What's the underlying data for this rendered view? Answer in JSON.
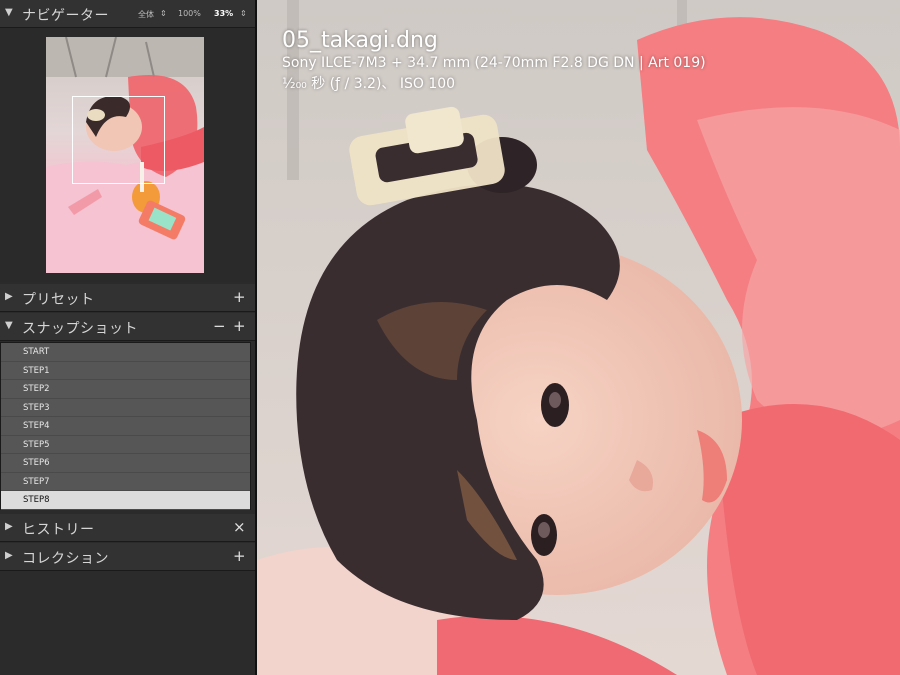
{
  "navigator": {
    "title": "ナビゲーター",
    "zoom_fit": "全体",
    "zoom_100": "100%",
    "zoom_current": "33%"
  },
  "presets": {
    "title": "プリセット"
  },
  "snapshots": {
    "title": "スナップショット",
    "items": [
      "START",
      "STEP1",
      "STEP2",
      "STEP3",
      "STEP4",
      "STEP5",
      "STEP6",
      "STEP7",
      "STEP8"
    ],
    "selected": "STEP8"
  },
  "history": {
    "title": "ヒストリー"
  },
  "collections": {
    "title": "コレクション"
  },
  "photo_info": {
    "filename": "05_takagi.dng",
    "camera": "Sony ILCE-7M3 + 34.7 mm (24-70mm F2.8 DG DN | Art 019)",
    "exposure": "¹⁄₂₀₀ 秒 (ƒ / 3.2)、 ISO 100"
  },
  "colors": {
    "accent": "#f0636a",
    "panel": "#2b2b2b",
    "selected_row": "#dcdcdc"
  }
}
